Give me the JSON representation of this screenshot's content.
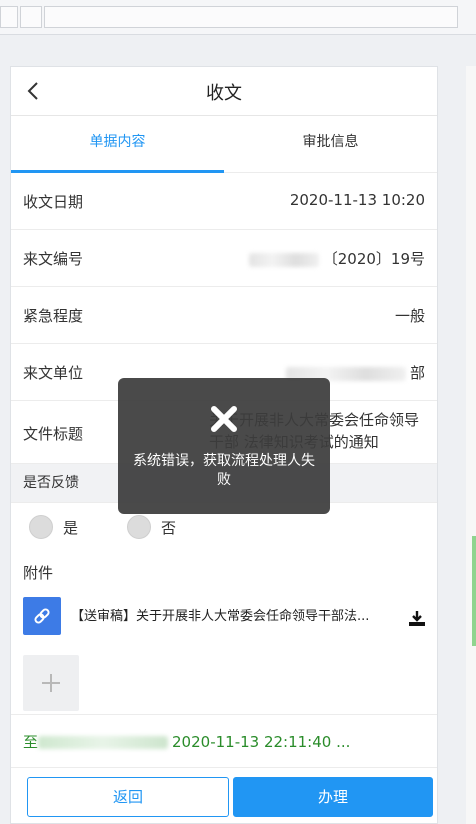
{
  "header": {
    "title": "收文"
  },
  "tabs": [
    {
      "label": "单据内容",
      "active": true
    },
    {
      "label": "审批信息",
      "active": false
    }
  ],
  "fields": {
    "date": {
      "label": "收文日期",
      "value": "2020-11-13 10:20"
    },
    "doc_no": {
      "label": "来文编号",
      "value": "〔2020〕19号"
    },
    "urgency": {
      "label": "紧急程度",
      "value": "一般"
    },
    "unit": {
      "label": "来文单位",
      "value": "部"
    },
    "title": {
      "label": "文件标题",
      "value": "关于开展非人大常委会任命领导干部 法律知识考试的通知"
    }
  },
  "feedback": {
    "label": "是否反馈",
    "options": [
      {
        "label": "是"
      },
      {
        "label": "否"
      }
    ]
  },
  "attachments": {
    "title": "附件",
    "items": [
      {
        "name": "【送审稿】关于开展非人大常委会任命领导干部法..."
      }
    ]
  },
  "flow": {
    "text": "2020-11-13 22:11:40 ...",
    "prefix": "至"
  },
  "buttons": {
    "back": "返回",
    "handle": "办理"
  },
  "toast": {
    "message": "系统错误，获取流程处理人失败"
  },
  "colors": {
    "accent": "#2196f3",
    "flow_green": "#2a8c2a",
    "toast_bg": "#3c3c3c"
  }
}
